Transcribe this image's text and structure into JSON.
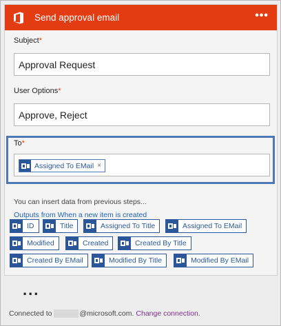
{
  "header": {
    "title": "Send approval email",
    "more_label": "•••",
    "brand_color": "#e33c13"
  },
  "fields": {
    "subject": {
      "label": "Subject",
      "required_mark": "*",
      "value": "Approval Request"
    },
    "user_options": {
      "label": "User Options",
      "required_mark": "*",
      "value": "Approve, Reject"
    },
    "to": {
      "label": "To",
      "required_mark": "*",
      "token_label": "Assigned To EMail",
      "remove_label": "×"
    }
  },
  "dynamic_content": {
    "hint": "You can insert data from previous steps...",
    "group_title": "Outputs from When a new item is created",
    "tokens": [
      "ID",
      "Title",
      "Assigned To Title",
      "Assigned To EMail",
      "Modified",
      "Created",
      "Created By Title",
      "Created By EMail",
      "Modified By Title",
      "Modified By EMail"
    ]
  },
  "add_step_label": "...",
  "footer": {
    "prefix": "Connected to",
    "domain": "@microsoft.com.",
    "change_link": "Change connection."
  },
  "icons": {
    "header": "office-logo-icon",
    "token": "sharepoint-token-icon"
  }
}
